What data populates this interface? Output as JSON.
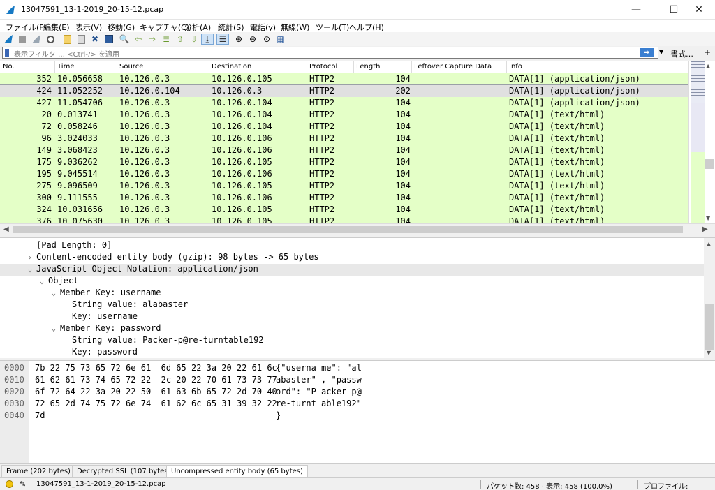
{
  "window": {
    "title": "13047591_13-1-2019_20-15-12.pcap",
    "minimize": "—",
    "maximize": "☐",
    "close": "✕"
  },
  "menu": [
    "ファイル(F)",
    "編集(E)",
    "表示(V)",
    "移動(G)",
    "キャプチャ(C)",
    "分析(A)",
    "統計(S)",
    "電話(y)",
    "無線(W)",
    "ツール(T)",
    "ヘルプ(H)"
  ],
  "filter": {
    "placeholder": "表示フィルタ … <Ctrl-/> を適用",
    "apply_icon": "arrow-right-icon",
    "format_label": "書式…",
    "add_label": "+"
  },
  "packet_list": {
    "columns": [
      "No.",
      "Time",
      "Source",
      "Destination",
      "Protocol",
      "Length",
      "Leftover Capture Data",
      "Info"
    ],
    "rows": [
      {
        "no": "352",
        "time": "10.056658",
        "src": "10.126.0.3",
        "dst": "10.126.0.105",
        "proto": "HTTP2",
        "len": "104",
        "info": "DATA[1] (application/json)"
      },
      {
        "no": "424",
        "time": "11.052252",
        "src": "10.126.0.104",
        "dst": "10.126.0.3",
        "proto": "HTTP2",
        "len": "202",
        "info": "DATA[1] (application/json)",
        "selected": true
      },
      {
        "no": "427",
        "time": "11.054706",
        "src": "10.126.0.3",
        "dst": "10.126.0.104",
        "proto": "HTTP2",
        "len": "104",
        "info": "DATA[1] (application/json)"
      },
      {
        "no": "20",
        "time": "0.013741",
        "src": "10.126.0.3",
        "dst": "10.126.0.104",
        "proto": "HTTP2",
        "len": "104",
        "info": "DATA[1] (text/html)"
      },
      {
        "no": "72",
        "time": "0.058246",
        "src": "10.126.0.3",
        "dst": "10.126.0.104",
        "proto": "HTTP2",
        "len": "104",
        "info": "DATA[1] (text/html)"
      },
      {
        "no": "96",
        "time": "3.024033",
        "src": "10.126.0.3",
        "dst": "10.126.0.106",
        "proto": "HTTP2",
        "len": "104",
        "info": "DATA[1] (text/html)"
      },
      {
        "no": "149",
        "time": "3.068423",
        "src": "10.126.0.3",
        "dst": "10.126.0.106",
        "proto": "HTTP2",
        "len": "104",
        "info": "DATA[1] (text/html)"
      },
      {
        "no": "175",
        "time": "9.036262",
        "src": "10.126.0.3",
        "dst": "10.126.0.105",
        "proto": "HTTP2",
        "len": "104",
        "info": "DATA[1] (text/html)"
      },
      {
        "no": "195",
        "time": "9.045514",
        "src": "10.126.0.3",
        "dst": "10.126.0.106",
        "proto": "HTTP2",
        "len": "104",
        "info": "DATA[1] (text/html)"
      },
      {
        "no": "275",
        "time": "9.096509",
        "src": "10.126.0.3",
        "dst": "10.126.0.105",
        "proto": "HTTP2",
        "len": "104",
        "info": "DATA[1] (text/html)"
      },
      {
        "no": "300",
        "time": "9.111555",
        "src": "10.126.0.3",
        "dst": "10.126.0.106",
        "proto": "HTTP2",
        "len": "104",
        "info": "DATA[1] (text/html)"
      },
      {
        "no": "324",
        "time": "10.031656",
        "src": "10.126.0.3",
        "dst": "10.126.0.105",
        "proto": "HTTP2",
        "len": "104",
        "info": "DATA[1] (text/html)"
      },
      {
        "no": "376",
        "time": "10.075630",
        "src": "10.126.0.3",
        "dst": "10.126.0.105",
        "proto": "HTTP2",
        "len": "104",
        "info": "DATA[1] (text/html)"
      }
    ]
  },
  "details": [
    {
      "text": "[Pad Length: 0]",
      "arrow": "",
      "indent": 0
    },
    {
      "text": "Content-encoded entity body (gzip): 98 bytes -> 65 bytes",
      "arrow": "›",
      "indent": 0
    },
    {
      "text": "JavaScript Object Notation: application/json",
      "arrow": "⌄",
      "indent": 0,
      "selected": true
    },
    {
      "text": "Object",
      "arrow": "⌄",
      "indent": 1
    },
    {
      "text": "Member Key: username",
      "arrow": "⌄",
      "indent": 2
    },
    {
      "text": "String value: alabaster",
      "arrow": "",
      "indent": 3
    },
    {
      "text": "Key: username",
      "arrow": "",
      "indent": 3
    },
    {
      "text": "Member Key: password",
      "arrow": "⌄",
      "indent": 2
    },
    {
      "text": "String value: Packer-p@re-turntable192",
      "arrow": "",
      "indent": 3
    },
    {
      "text": "Key: password",
      "arrow": "",
      "indent": 3
    }
  ],
  "bytes": [
    {
      "offset": "0000",
      "hex": "7b 22 75 73 65 72 6e 61  6d 65 22 3a 20 22 61 6c",
      "ascii": "{\"userna me\": \"al"
    },
    {
      "offset": "0010",
      "hex": "61 62 61 73 74 65 72 22  2c 20 22 70 61 73 73 77",
      "ascii": "abaster\" , \"passw"
    },
    {
      "offset": "0020",
      "hex": "6f 72 64 22 3a 20 22 50  61 63 6b 65 72 2d 70 40",
      "ascii": "ord\": \"P acker-p@"
    },
    {
      "offset": "0030",
      "hex": "72 65 2d 74 75 72 6e 74  61 62 6c 65 31 39 32 22",
      "ascii": "re-turnt able192\""
    },
    {
      "offset": "0040",
      "hex": "7d",
      "ascii": "}"
    }
  ],
  "bottom_tabs": [
    "Frame (202 bytes)",
    "Decrypted SSL (107 bytes)",
    "Uncompressed entity body (65 bytes)"
  ],
  "status": {
    "file": "13047591_13-1-2019_20-15-12.pcap",
    "packets": "パケット数: 458 · 表示: 458 (100.0%)",
    "profile": "プロファイル: Default"
  },
  "colors": {
    "row_bg": "#e4ffc7",
    "selected_bg": "#e0e0e0",
    "accent": "#3b7fd1"
  }
}
